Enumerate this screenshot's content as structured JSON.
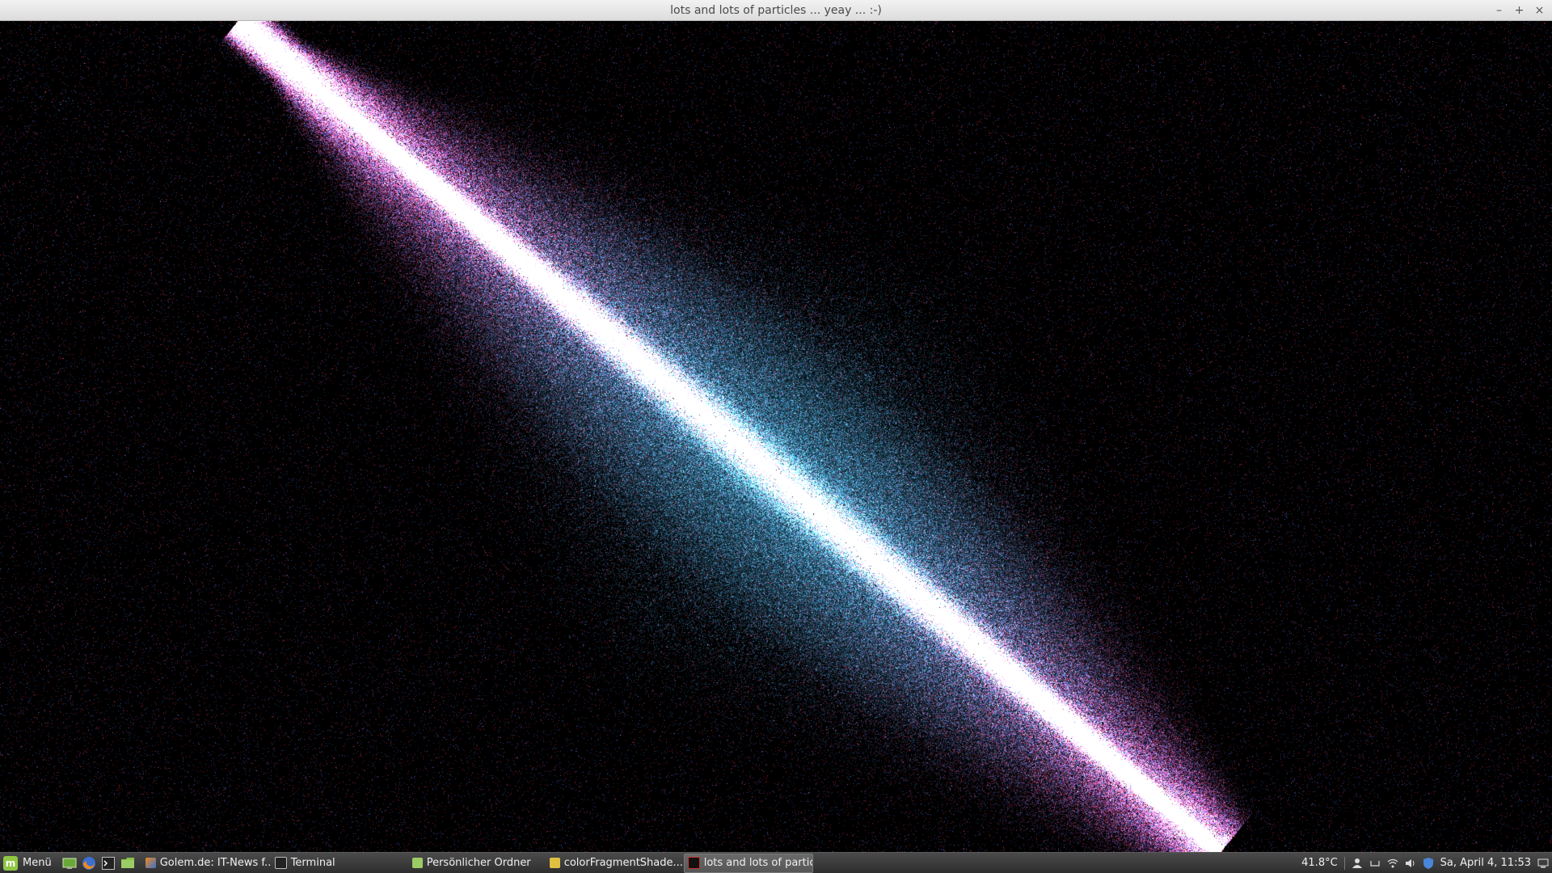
{
  "window": {
    "title": "lots and lots of particles ... yeay ... :-)",
    "controls": {
      "minimize": "–",
      "maximize": "+",
      "close": "×"
    }
  },
  "visualization": {
    "background_color": "#000000",
    "colors": {
      "streak": "#ff4d78",
      "core": "#ffffff",
      "glow": "#4fd2ff",
      "dust_red": "#c0304a",
      "dust_blue": "#4060c0"
    }
  },
  "taskbar": {
    "menu_label": "Menü",
    "launchers": [
      "desktop-icon",
      "firefox-icon",
      "terminal-icon",
      "folder-icon"
    ],
    "tasks": [
      {
        "label": "Golem.de: IT-News f...",
        "icon": "firefox-icon",
        "active": false
      },
      {
        "label": "Terminal",
        "icon": "terminal-icon",
        "active": false
      },
      {
        "label": "Persönlicher Ordner",
        "icon": "folder-icon",
        "active": false
      },
      {
        "label": "colorFragmentShade...",
        "icon": "editor-icon",
        "active": false
      },
      {
        "label": "lots and lots of particl...",
        "icon": "app-window-icon",
        "active": true
      }
    ],
    "tray": {
      "temperature": "41.8°C",
      "clock": "Sa, April 4, 11:53"
    }
  }
}
